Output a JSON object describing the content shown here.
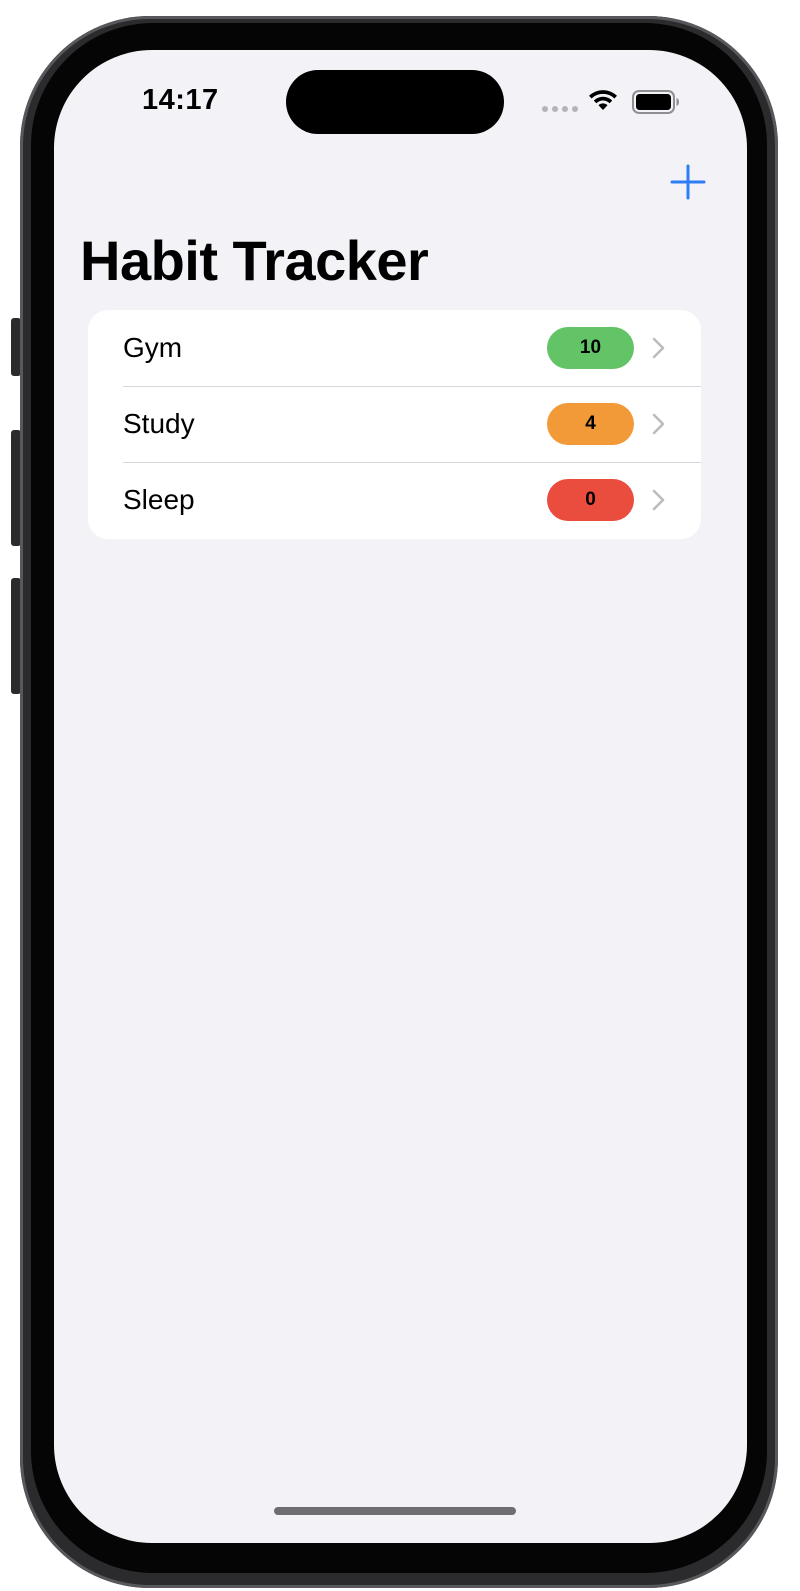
{
  "status_bar": {
    "time": "14:17",
    "wifi_icon": "wifi-icon",
    "battery_icon": "battery-full-icon"
  },
  "nav": {
    "add_icon": "plus-icon",
    "accent_color": "#2f7cf6"
  },
  "page": {
    "title": "Habit Tracker"
  },
  "habits": [
    {
      "name": "Gym",
      "count": "10",
      "badge_color": "#62c466"
    },
    {
      "name": "Study",
      "count": "4",
      "badge_color": "#f29a38"
    },
    {
      "name": "Sleep",
      "count": "0",
      "badge_color": "#ea4c3e"
    }
  ]
}
